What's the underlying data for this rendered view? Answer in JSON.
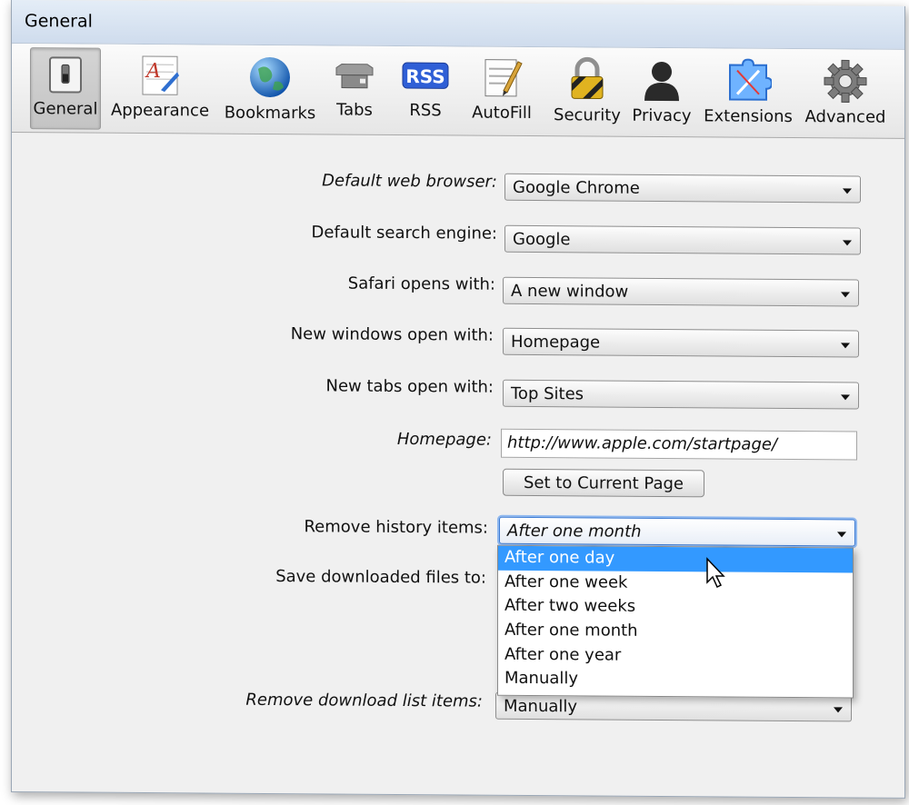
{
  "window": {
    "title": "General"
  },
  "toolbar": {
    "items": [
      {
        "label": "General",
        "icon": "toggle-switch-icon",
        "selected": true
      },
      {
        "label": "Appearance",
        "icon": "font-appearance-icon"
      },
      {
        "label": "Bookmarks",
        "icon": "globe-icon"
      },
      {
        "label": "Tabs",
        "icon": "tabs-icon"
      },
      {
        "label": "RSS",
        "icon": "rss-icon",
        "badge": "RSS"
      },
      {
        "label": "AutoFill",
        "icon": "autofill-form-icon"
      },
      {
        "label": "Security",
        "icon": "padlock-icon"
      },
      {
        "label": "Privacy",
        "icon": "person-silhouette-icon"
      },
      {
        "label": "Extensions",
        "icon": "puzzle-compass-icon"
      },
      {
        "label": "Advanced",
        "icon": "gear-icon"
      }
    ]
  },
  "settings": {
    "default_browser": {
      "label": "Default web browser:",
      "value": "Google Chrome"
    },
    "search_engine": {
      "label": "Default search engine:",
      "value": "Google"
    },
    "safari_opens": {
      "label": "Safari opens with:",
      "value": "A new window"
    },
    "new_windows": {
      "label": "New windows open with:",
      "value": "Homepage"
    },
    "new_tabs": {
      "label": "New tabs open with:",
      "value": "Top Sites"
    },
    "homepage": {
      "label": "Homepage:",
      "value": "http://www.apple.com/startpage/"
    },
    "set_current_button": "Set to Current Page",
    "remove_history": {
      "label": "Remove history items:",
      "value": "After one month"
    },
    "save_downloads": {
      "label": "Save downloaded files to:"
    },
    "remove_download": {
      "label": "Remove download list items:",
      "value": "Manually"
    }
  },
  "history_menu": {
    "options": [
      "After one day",
      "After one week",
      "After two weeks",
      "After one month",
      "After one year",
      "Manually"
    ],
    "highlighted_index": 0
  },
  "colors": {
    "accent": "#3399ff",
    "focus_ring": "#8fb8ef"
  }
}
